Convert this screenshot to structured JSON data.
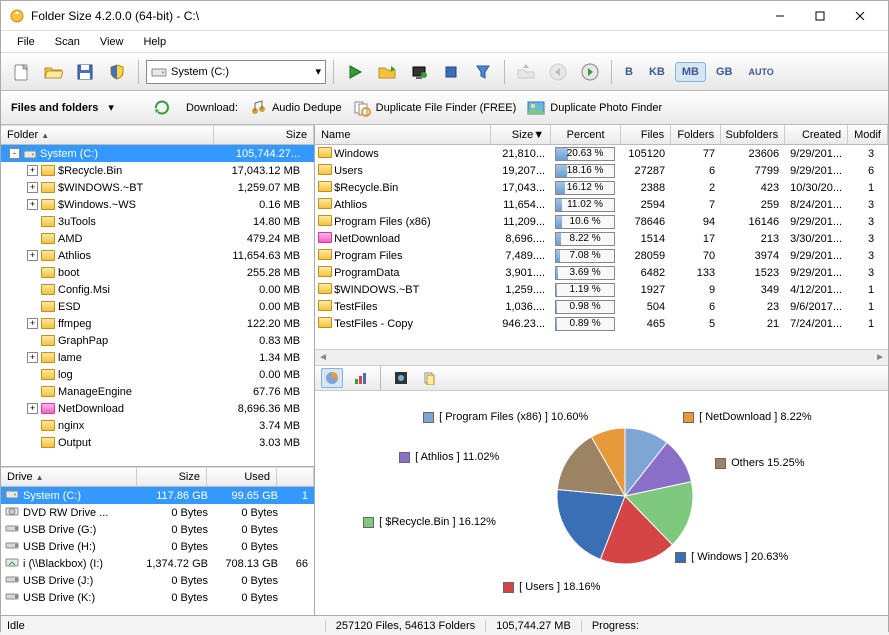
{
  "window": {
    "title": "Folder Size 4.2.0.0 (64-bit) - C:\\"
  },
  "menu": {
    "file": "File",
    "scan": "Scan",
    "view": "View",
    "help": "Help"
  },
  "toolbar": {
    "drive_label": "System (C:)",
    "size_b": "B",
    "size_kb": "KB",
    "size_mb": "MB",
    "size_gb": "GB",
    "size_auto": "AUTO"
  },
  "toolbar2": {
    "files_folders": "Files and folders",
    "download": "Download:",
    "audio_dedupe": "Audio Dedupe",
    "dupe_file": "Duplicate File Finder (FREE)",
    "dupe_photo": "Duplicate Photo Finder"
  },
  "tree_header": {
    "folder": "Folder",
    "size": "Size"
  },
  "tree": [
    {
      "depth": 0,
      "exp": "-",
      "icon": "drive",
      "name": "System (C:)",
      "size": "105,744.27...",
      "selected": true
    },
    {
      "depth": 1,
      "exp": "+",
      "icon": "folder",
      "name": "$Recycle.Bin",
      "size": "17,043.12 MB"
    },
    {
      "depth": 1,
      "exp": "+",
      "icon": "folder",
      "name": "$WINDOWS.~BT",
      "size": "1,259.07 MB"
    },
    {
      "depth": 1,
      "exp": "+",
      "icon": "folder",
      "name": "$Windows.~WS",
      "size": "0.16 MB"
    },
    {
      "depth": 1,
      "exp": " ",
      "icon": "folder",
      "name": "3uTools",
      "size": "14.80 MB"
    },
    {
      "depth": 1,
      "exp": " ",
      "icon": "folder",
      "name": "AMD",
      "size": "479.24 MB"
    },
    {
      "depth": 1,
      "exp": "+",
      "icon": "folder",
      "name": "Athlios",
      "size": "11,654.63 MB"
    },
    {
      "depth": 1,
      "exp": " ",
      "icon": "folder",
      "name": "boot",
      "size": "255.28 MB"
    },
    {
      "depth": 1,
      "exp": " ",
      "icon": "folder",
      "name": "Config.Msi",
      "size": "0.00 MB"
    },
    {
      "depth": 1,
      "exp": " ",
      "icon": "folder",
      "name": "ESD",
      "size": "0.00 MB"
    },
    {
      "depth": 1,
      "exp": "+",
      "icon": "folder",
      "name": "ffmpeg",
      "size": "122.20 MB"
    },
    {
      "depth": 1,
      "exp": " ",
      "icon": "folder",
      "name": "GraphPap",
      "size": "0.83 MB"
    },
    {
      "depth": 1,
      "exp": "+",
      "icon": "folder",
      "name": "lame",
      "size": "1.34 MB"
    },
    {
      "depth": 1,
      "exp": " ",
      "icon": "folder",
      "name": "log",
      "size": "0.00 MB"
    },
    {
      "depth": 1,
      "exp": " ",
      "icon": "folder",
      "name": "ManageEngine",
      "size": "67.76 MB"
    },
    {
      "depth": 1,
      "exp": "+",
      "icon": "pink",
      "name": "NetDownload",
      "size": "8,696.36 MB"
    },
    {
      "depth": 1,
      "exp": " ",
      "icon": "folder",
      "name": "nginx",
      "size": "3.74 MB"
    },
    {
      "depth": 1,
      "exp": " ",
      "icon": "folder",
      "name": "Output",
      "size": "3.03 MB"
    }
  ],
  "drive_header": {
    "drive": "Drive",
    "size": "Size",
    "used": "Used"
  },
  "drives": [
    {
      "icon": "hdd",
      "name": "System (C:)",
      "size": "117.86 GB",
      "used": "99.65 GB",
      "extra": "1",
      "selected": true
    },
    {
      "icon": "dvd",
      "name": "DVD RW Drive ...",
      "size": "0 Bytes",
      "used": "0 Bytes",
      "extra": ""
    },
    {
      "icon": "usb",
      "name": "USB Drive (G:)",
      "size": "0 Bytes",
      "used": "0 Bytes",
      "extra": ""
    },
    {
      "icon": "usb",
      "name": "USB Drive (H:)",
      "size": "0 Bytes",
      "used": "0 Bytes",
      "extra": ""
    },
    {
      "icon": "net",
      "name": "i (\\\\Blackbox) (I:)",
      "size": "1,374.72 GB",
      "used": "708.13 GB",
      "extra": "66"
    },
    {
      "icon": "usb",
      "name": "USB Drive (J:)",
      "size": "0 Bytes",
      "used": "0 Bytes",
      "extra": ""
    },
    {
      "icon": "usb",
      "name": "USB Drive (K:)",
      "size": "0 Bytes",
      "used": "0 Bytes",
      "extra": ""
    }
  ],
  "list_header": {
    "name": "Name",
    "size": "Size",
    "percent": "Percent",
    "files": "Files",
    "folders": "Folders",
    "subfolders": "Subfolders",
    "created": "Created",
    "modified": "Modif"
  },
  "list": [
    {
      "icon": "folder",
      "name": "Windows",
      "size": "21,810...",
      "pct": "20.63 %",
      "pctw": 20.63,
      "files": "105120",
      "folders": "77",
      "sub": "23606",
      "created": "9/29/201...",
      "mod": "3"
    },
    {
      "icon": "folder",
      "name": "Users",
      "size": "19,207...",
      "pct": "18.16 %",
      "pctw": 18.16,
      "files": "27287",
      "folders": "6",
      "sub": "7799",
      "created": "9/29/201...",
      "mod": "6"
    },
    {
      "icon": "folder",
      "name": "$Recycle.Bin",
      "size": "17,043...",
      "pct": "16.12 %",
      "pctw": 16.12,
      "files": "2388",
      "folders": "2",
      "sub": "423",
      "created": "10/30/20...",
      "mod": "1"
    },
    {
      "icon": "folder",
      "name": "Athlios",
      "size": "11,654...",
      "pct": "11.02 %",
      "pctw": 11.02,
      "files": "2594",
      "folders": "7",
      "sub": "259",
      "created": "8/24/201...",
      "mod": "3"
    },
    {
      "icon": "folder",
      "name": "Program Files (x86)",
      "size": "11,209...",
      "pct": "10.6 %",
      "pctw": 10.6,
      "files": "78646",
      "folders": "94",
      "sub": "16146",
      "created": "9/29/201...",
      "mod": "3"
    },
    {
      "icon": "pink",
      "name": "NetDownload",
      "size": "8,696....",
      "pct": "8.22 %",
      "pctw": 8.22,
      "files": "1514",
      "folders": "17",
      "sub": "213",
      "created": "3/30/201...",
      "mod": "3"
    },
    {
      "icon": "folder",
      "name": "Program Files",
      "size": "7,489....",
      "pct": "7.08 %",
      "pctw": 7.08,
      "files": "28059",
      "folders": "70",
      "sub": "3974",
      "created": "9/29/201...",
      "mod": "3"
    },
    {
      "icon": "folder",
      "name": "ProgramData",
      "size": "3,901....",
      "pct": "3.69 %",
      "pctw": 3.69,
      "files": "6482",
      "folders": "133",
      "sub": "1523",
      "created": "9/29/201...",
      "mod": "3"
    },
    {
      "icon": "folder",
      "name": "$WINDOWS.~BT",
      "size": "1,259....",
      "pct": "1.19 %",
      "pctw": 1.19,
      "files": "1927",
      "folders": "9",
      "sub": "349",
      "created": "4/12/201...",
      "mod": "1"
    },
    {
      "icon": "folder",
      "name": "TestFiles",
      "size": "1,036....",
      "pct": "0.98 %",
      "pctw": 0.98,
      "files": "504",
      "folders": "6",
      "sub": "23",
      "created": "9/6/2017...",
      "mod": "1"
    },
    {
      "icon": "folder",
      "name": "TestFiles - Copy",
      "size": "946.23...",
      "pct": "0.89 %",
      "pctw": 0.89,
      "files": "465",
      "folders": "5",
      "sub": "21",
      "created": "7/24/201...",
      "mod": "1"
    }
  ],
  "chart_data": {
    "type": "pie",
    "title": "",
    "series": [
      {
        "name": "[ Program Files (x86) ] 10.60%",
        "value": 10.6,
        "color": "#7fa5d4"
      },
      {
        "name": "[ Athlios ] 11.02%",
        "value": 11.02,
        "color": "#8a6fc9"
      },
      {
        "name": "[ $Recycle.Bin ] 16.12%",
        "value": 16.12,
        "color": "#7fc97f"
      },
      {
        "name": "[ Users ] 18.16%",
        "value": 18.16,
        "color": "#d64545"
      },
      {
        "name": "[ Windows ] 20.63%",
        "value": 20.63,
        "color": "#3b6fb5"
      },
      {
        "name": "Others 15.25%",
        "value": 15.25,
        "color": "#9b8363"
      },
      {
        "name": "[ NetDownload ] 8.22%",
        "value": 8.22,
        "color": "#e79a3c"
      }
    ]
  },
  "status": {
    "idle": "Idle",
    "counts": "257120 Files, 54613 Folders",
    "total": "105,744.27 MB",
    "progress_label": "Progress:"
  }
}
